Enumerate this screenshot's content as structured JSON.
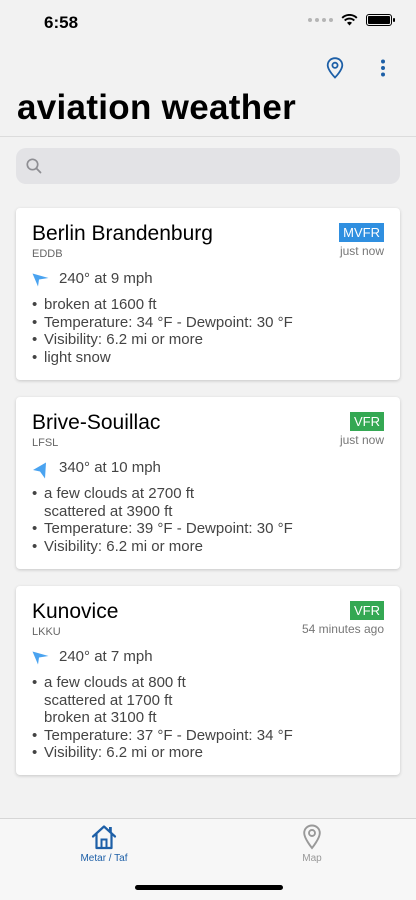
{
  "status_bar": {
    "time": "6:58"
  },
  "header": {
    "title": "aviation weather",
    "location_icon": "location-pin-icon",
    "menu_icon": "more-vertical-icon"
  },
  "search": {
    "placeholder": "",
    "value": ""
  },
  "stations": [
    {
      "name": "Berlin Brandenburg",
      "code": "EDDB",
      "category": "MVFR",
      "updated": "just now",
      "wind": "240° at 9 mph",
      "details": [
        "broken at 1600 ft",
        "Temperature: 34 °F - Dewpoint: 30 °F",
        "Visibility: 6.2 mi or more",
        "light snow"
      ]
    },
    {
      "name": "Brive-Souillac",
      "code": "LFSL",
      "category": "VFR",
      "updated": "just now",
      "wind": "340° at 10 mph",
      "clouds": [
        "a few clouds at 2700 ft",
        "scattered at 3900 ft"
      ],
      "details": [
        "Temperature: 39 °F - Dewpoint: 30 °F",
        "Visibility: 6.2 mi or more"
      ]
    },
    {
      "name": "Kunovice",
      "code": "LKKU",
      "category": "VFR",
      "updated": "54 minutes ago",
      "wind": "240° at 7 mph",
      "clouds": [
        "a few clouds at 800 ft",
        "scattered at 1700 ft",
        "broken at 3100 ft"
      ],
      "details": [
        "Temperature: 37 °F - Dewpoint: 34 °F",
        "Visibility: 6.2 mi or more"
      ]
    }
  ],
  "tabs": [
    {
      "label": "Metar / Taf",
      "icon": "home-icon",
      "active": true
    },
    {
      "label": "Map",
      "icon": "map-pin-icon",
      "active": false
    }
  ],
  "colors": {
    "accent": "#1d5fa7",
    "mvfr": "#2f8fe0",
    "vfr": "#34a853",
    "wind_arrow": "#4aa3f0"
  }
}
